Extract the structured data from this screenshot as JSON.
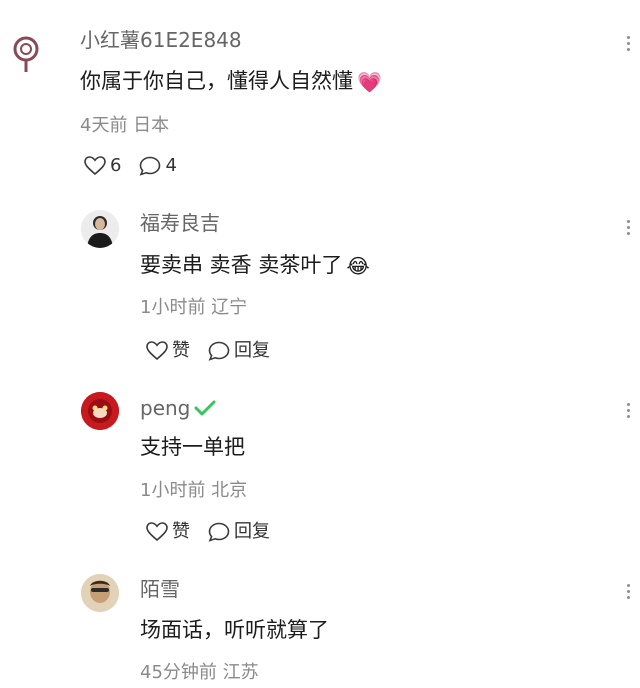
{
  "main_comment": {
    "username": "小红薯61E2E848",
    "text": "你属于你自己，懂得人自然懂",
    "emoji": "💗",
    "meta": "4天前 日本",
    "likes": "6",
    "comments": "4",
    "avatar_icon": "location-pin-icon"
  },
  "replies": [
    {
      "username": "福寿良吉",
      "text": "要卖串 卖香 卖茶叶了",
      "emoji": "😂",
      "meta": "1小时前 辽宁",
      "like_label": "赞",
      "reply_label": "回复"
    },
    {
      "username": "peng",
      "verified": true,
      "text": "支持一单把",
      "meta": "1小时前 北京",
      "like_label": "赞",
      "reply_label": "回复"
    },
    {
      "username": "陌雪",
      "text": "场面话，听听就算了",
      "meta": "45分钟前 江苏"
    }
  ],
  "colors": {
    "name": "#666666",
    "meta": "#8a8a8a",
    "verified": "#34c759",
    "icon": "#3a3a3a"
  }
}
